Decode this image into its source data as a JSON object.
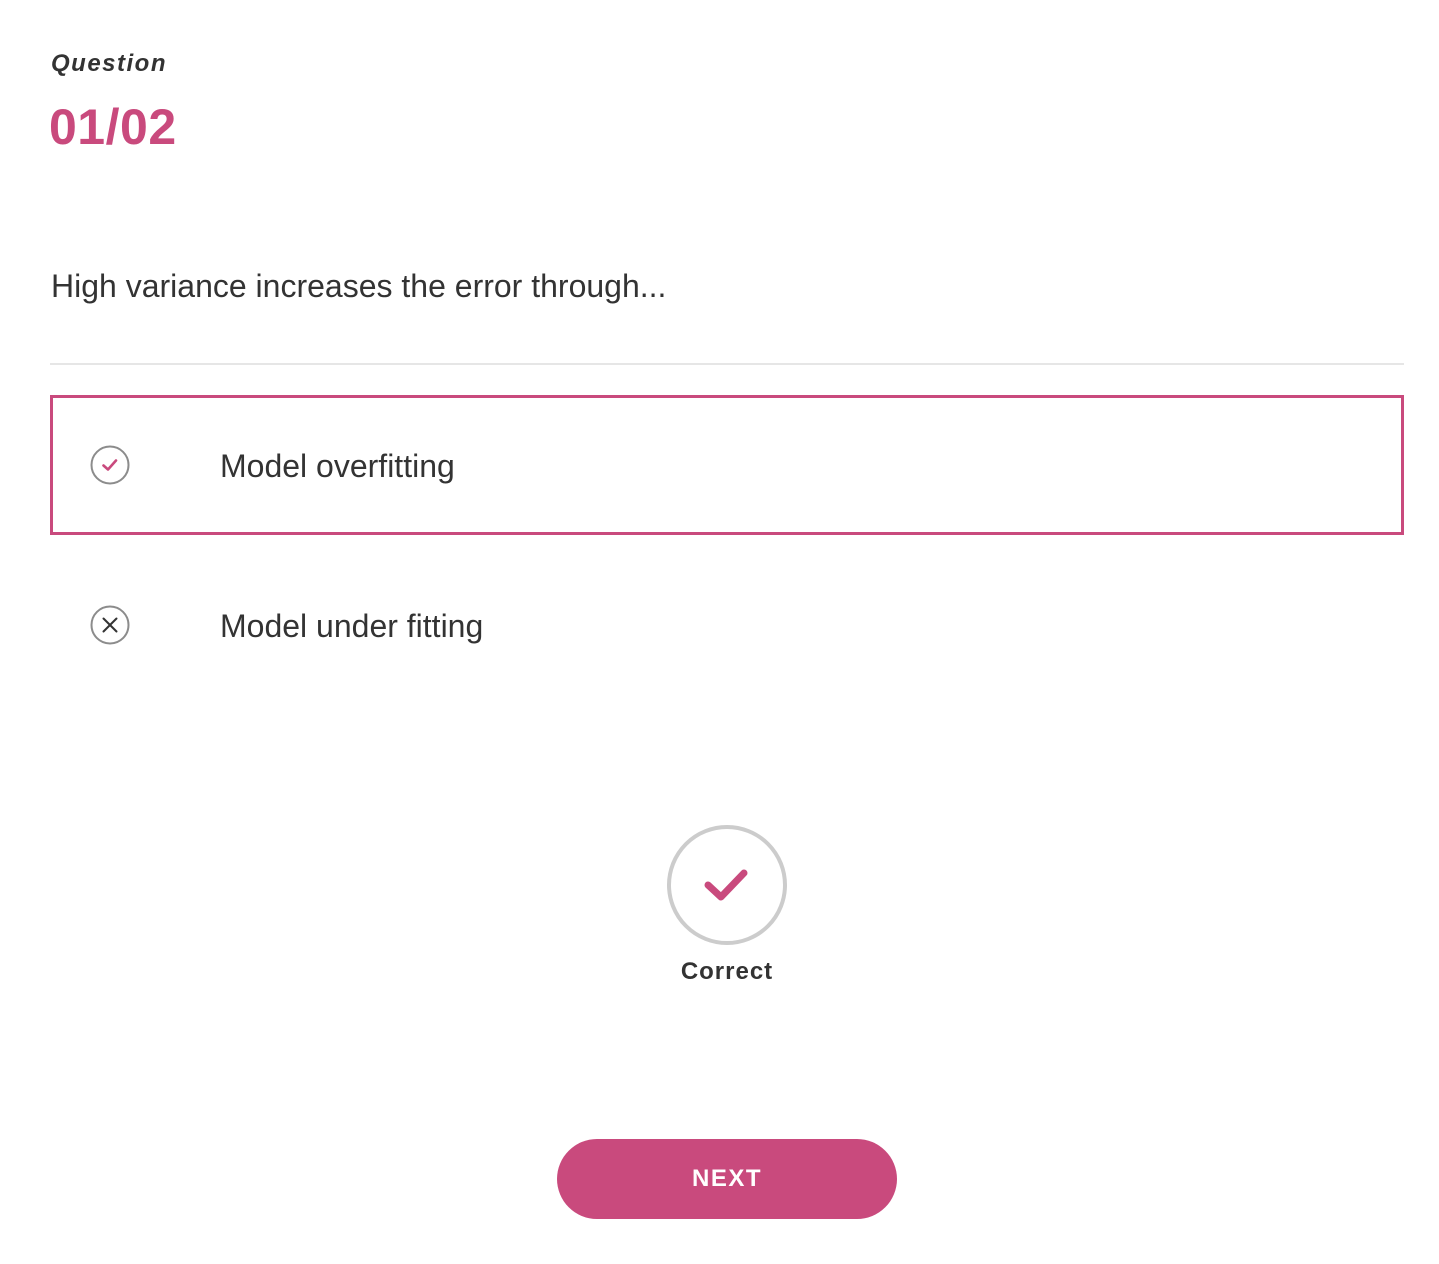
{
  "header": {
    "label": "Question",
    "counter": "01/02"
  },
  "question": {
    "text": "High variance increases the error through..."
  },
  "options": [
    {
      "label": "Model overfitting",
      "state": "selected-correct",
      "icon": "check-circle-icon"
    },
    {
      "label": "Model under fitting",
      "state": "incorrect",
      "icon": "x-circle-icon"
    }
  ],
  "result": {
    "label": "Correct",
    "icon": "check-circle-icon"
  },
  "actions": {
    "next_label": "NEXT"
  },
  "colors": {
    "accent": "#c94a7d",
    "text": "#333333",
    "divider": "#e6e6e6",
    "icon_ring": "#cccccc"
  }
}
